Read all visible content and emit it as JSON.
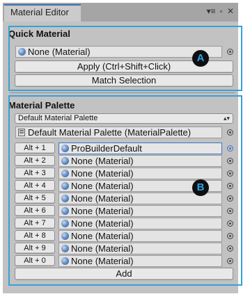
{
  "window": {
    "tab_title": "Material Editor"
  },
  "quick_material": {
    "title": "Quick Material",
    "material_value": "None (Material)",
    "apply_label": "Apply (Ctrl+Shift+Click)",
    "match_label": "Match Selection"
  },
  "material_palette": {
    "title": "Material Palette",
    "dropdown_value": "Default Material Palette",
    "palette_asset": "Default Material Palette (MaterialPalette)",
    "rows": [
      {
        "shortcut": "Alt + 1",
        "material": "ProBuilderDefault"
      },
      {
        "shortcut": "Alt + 2",
        "material": "None (Material)"
      },
      {
        "shortcut": "Alt + 3",
        "material": "None (Material)"
      },
      {
        "shortcut": "Alt + 4",
        "material": "None (Material)"
      },
      {
        "shortcut": "Alt + 5",
        "material": "None (Material)"
      },
      {
        "shortcut": "Alt + 6",
        "material": "None (Material)"
      },
      {
        "shortcut": "Alt + 7",
        "material": "None (Material)"
      },
      {
        "shortcut": "Alt + 8",
        "material": "None (Material)"
      },
      {
        "shortcut": "Alt + 9",
        "material": "None (Material)"
      },
      {
        "shortcut": "Alt + 0",
        "material": "None (Material)"
      }
    ],
    "add_label": "Add"
  },
  "callouts": {
    "a": "A",
    "b": "B"
  },
  "icons": {
    "menu": "menu-icon",
    "maximize": "maximize-icon",
    "close": "close-icon",
    "picker": "object-picker-icon",
    "sphere": "material-sphere-icon"
  },
  "colors": {
    "highlight": "#35a2d8",
    "marker_text": "#2aa4e0",
    "selected_field": "#3d72c8",
    "tab_accent": "#3a72b0"
  }
}
